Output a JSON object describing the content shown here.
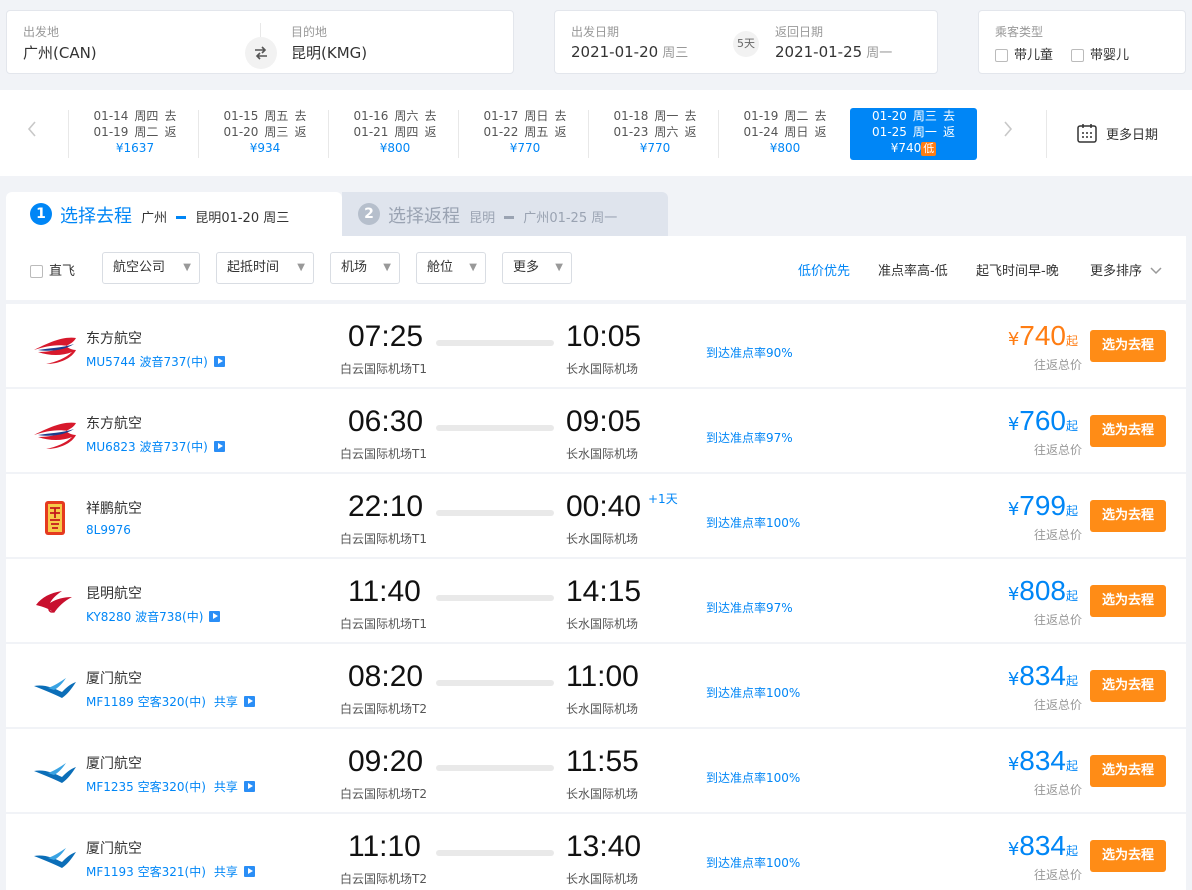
{
  "search": {
    "from_label": "出发地",
    "from_value": "广州(CAN)",
    "to_label": "目的地",
    "to_value": "昆明(KMG)",
    "depart_label": "出发日期",
    "depart_date": "2021-01-20",
    "depart_week": "周三",
    "return_label": "返回日期",
    "return_date": "2021-01-25",
    "return_week": "周一",
    "span": "5天",
    "pax_label": "乘客类型",
    "child": "带儿童",
    "infant": "带婴儿"
  },
  "date_strip": [
    {
      "out": "01-14",
      "out_wk": "周四",
      "out_tag": "去",
      "ret": "01-19",
      "ret_wk": "周二",
      "ret_tag": "返",
      "price": "¥1637"
    },
    {
      "out": "01-15",
      "out_wk": "周五",
      "out_tag": "去",
      "ret": "01-20",
      "ret_wk": "周三",
      "ret_tag": "返",
      "price": "¥934"
    },
    {
      "out": "01-16",
      "out_wk": "周六",
      "out_tag": "去",
      "ret": "01-21",
      "ret_wk": "周四",
      "ret_tag": "返",
      "price": "¥800"
    },
    {
      "out": "01-17",
      "out_wk": "周日",
      "out_tag": "去",
      "ret": "01-22",
      "ret_wk": "周五",
      "ret_tag": "返",
      "price": "¥770"
    },
    {
      "out": "01-18",
      "out_wk": "周一",
      "out_tag": "去",
      "ret": "01-23",
      "ret_wk": "周六",
      "ret_tag": "返",
      "price": "¥770"
    },
    {
      "out": "01-19",
      "out_wk": "周二",
      "out_tag": "去",
      "ret": "01-24",
      "ret_wk": "周日",
      "ret_tag": "返",
      "price": "¥800"
    },
    {
      "out": "01-20",
      "out_wk": "周三",
      "out_tag": "去",
      "ret": "01-25",
      "ret_wk": "周一",
      "ret_tag": "返",
      "price": "¥740",
      "badge": "低"
    }
  ],
  "more_dates": "更多日期",
  "steps": {
    "s1_num": "1",
    "s1_title": "选择去程",
    "s1_from": "广州",
    "s1_to": "昆明",
    "s1_date": "01-20 周三",
    "s2_num": "2",
    "s2_title": "选择返程",
    "s2_from": "昆明",
    "s2_to": "广州",
    "s2_date": "01-25 周一"
  },
  "filters": {
    "direct": "直飞",
    "airline": "航空公司",
    "time": "起抵时间",
    "airport": "机场",
    "cabin": "舱位",
    "more": "更多",
    "sort_low": "低价优先",
    "sort_ontime": "准点率高-低",
    "sort_early": "起飞时间早-晚",
    "sort_more": "更多排序"
  },
  "flights": [
    {
      "airline": "东方航空",
      "code": "MU5744 波音737(中)",
      "share": "",
      "dep": "07:25",
      "arr": "10:05",
      "dep_ap": "白云国际机场T1",
      "arr_ap": "长水国际机场",
      "plus": "",
      "ontime": "到达准点率90%",
      "price": "740",
      "lowest": true,
      "logo": "china-eastern"
    },
    {
      "airline": "东方航空",
      "code": "MU6823 波音737(中)",
      "share": "",
      "dep": "06:30",
      "arr": "09:05",
      "dep_ap": "白云国际机场T1",
      "arr_ap": "长水国际机场",
      "plus": "",
      "ontime": "到达准点率97%",
      "price": "760",
      "lowest": false,
      "logo": "china-eastern"
    },
    {
      "airline": "祥鹏航空",
      "code": "8L9976",
      "share": "",
      "dep": "22:10",
      "arr": "00:40",
      "dep_ap": "白云国际机场T1",
      "arr_ap": "长水国际机场",
      "plus": "+1天",
      "ontime": "到达准点率100%",
      "price": "799",
      "lowest": false,
      "logo": "lucky-air"
    },
    {
      "airline": "昆明航空",
      "code": "KY8280 波音738(中)",
      "share": "",
      "dep": "11:40",
      "arr": "14:15",
      "dep_ap": "白云国际机场T1",
      "arr_ap": "长水国际机场",
      "plus": "",
      "ontime": "到达准点率97%",
      "price": "808",
      "lowest": false,
      "logo": "kunming-airlines"
    },
    {
      "airline": "厦门航空",
      "code": "MF1189 空客320(中)",
      "share": "共享",
      "dep": "08:20",
      "arr": "11:00",
      "dep_ap": "白云国际机场T2",
      "arr_ap": "长水国际机场",
      "plus": "",
      "ontime": "到达准点率100%",
      "price": "834",
      "lowest": false,
      "logo": "xiamen-airlines"
    },
    {
      "airline": "厦门航空",
      "code": "MF1235 空客320(中)",
      "share": "共享",
      "dep": "09:20",
      "arr": "11:55",
      "dep_ap": "白云国际机场T2",
      "arr_ap": "长水国际机场",
      "plus": "",
      "ontime": "到达准点率100%",
      "price": "834",
      "lowest": false,
      "logo": "xiamen-airlines"
    },
    {
      "airline": "厦门航空",
      "code": "MF1193 空客321(中)",
      "share": "共享",
      "dep": "11:10",
      "arr": "13:40",
      "dep_ap": "白云国际机场T2",
      "arr_ap": "长水国际机场",
      "plus": "",
      "ontime": "到达准点率100%",
      "price": "834",
      "lowest": false,
      "logo": "xiamen-airlines"
    }
  ],
  "labels": {
    "currency": "¥",
    "qi": "起",
    "round_trip": "往返总价",
    "select_btn": "选为去程"
  },
  "colors": {
    "accent": "#0086f6",
    "orange": "#ff7d13",
    "button": "#ff8c16"
  }
}
